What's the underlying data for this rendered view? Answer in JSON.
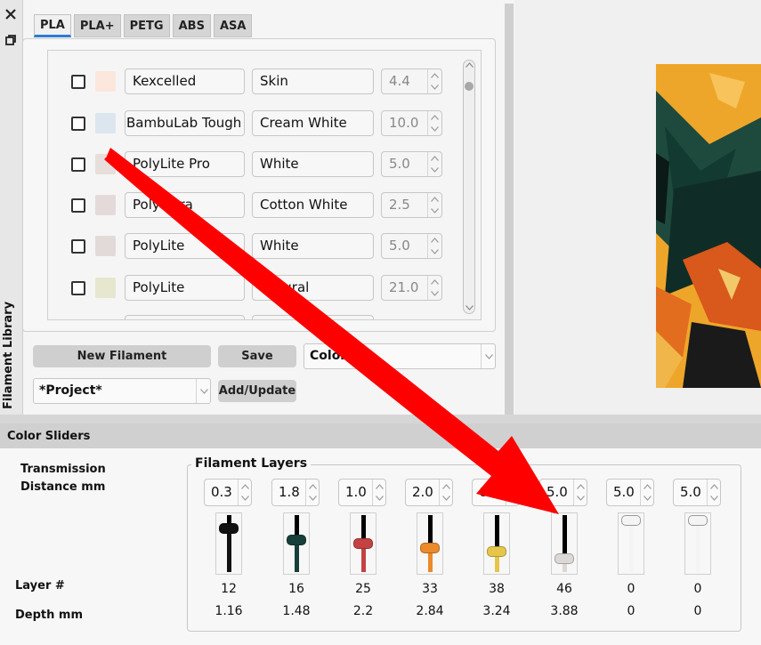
{
  "sidebar": {
    "label": "Filament Library"
  },
  "tabs": [
    "PLA",
    "PLA+",
    "PETG",
    "ABS",
    "ASA"
  ],
  "filaments": [
    {
      "brand": "Kexcelled",
      "name": "Skin",
      "value": "4.4",
      "color": "#fbe7dc"
    },
    {
      "brand": "BambuLab Tough",
      "name": "Cream White",
      "value": "10.0",
      "color": "#dce6ee"
    },
    {
      "brand": "PolyLite Pro",
      "name": "White",
      "value": "5.0",
      "color": "#e7dedc"
    },
    {
      "brand": "PolyTerra",
      "name": "Cotton White",
      "value": "2.5",
      "color": "#e5dada"
    },
    {
      "brand": "PolyLite",
      "name": "White",
      "value": "5.0",
      "color": "#e2dad8"
    },
    {
      "brand": "PolyLite",
      "name": "Natural",
      "value": "21.0",
      "color": "#e7e6cf"
    }
  ],
  "buttons": {
    "new_filament": "New Filament",
    "save": "Save",
    "add_update": "Add/Update"
  },
  "combos": {
    "sort": "Color",
    "project": "*Project*"
  },
  "color_sliders": {
    "header": "Color Sliders",
    "transmission_label_1": "Transmission",
    "transmission_label_2": "Distance mm",
    "group_title": "Filament Layers",
    "layer_label": "Layer #",
    "depth_label": "Depth mm",
    "layers": [
      {
        "td": "0.3",
        "layer": "12",
        "depth": "1.16",
        "color": "#111111",
        "level": 0.82
      },
      {
        "td": "1.8",
        "layer": "16",
        "depth": "1.48",
        "color": "#173f3a",
        "level": 0.58
      },
      {
        "td": "1.0",
        "layer": "25",
        "depth": "2.2",
        "color": "#c34242",
        "level": 0.5
      },
      {
        "td": "2.0",
        "layer": "33",
        "depth": "2.84",
        "color": "#eb8a2a",
        "level": 0.4
      },
      {
        "td": "6.5",
        "layer": "38",
        "depth": "3.24",
        "color": "#e6c64a",
        "level": 0.33
      },
      {
        "td": "5.0",
        "layer": "46",
        "depth": "3.88",
        "color": "#dcd8d6",
        "level": 0.18
      },
      {
        "td": "5.0",
        "layer": "0",
        "depth": "0",
        "color": "#f4f4f4",
        "level": 1.0
      },
      {
        "td": "5.0",
        "layer": "0",
        "depth": "0",
        "color": "#f4f4f4",
        "level": 1.0
      }
    ]
  },
  "colors": {
    "accent": "#2b7bd6",
    "annotation_arrow": "#ff0000"
  }
}
